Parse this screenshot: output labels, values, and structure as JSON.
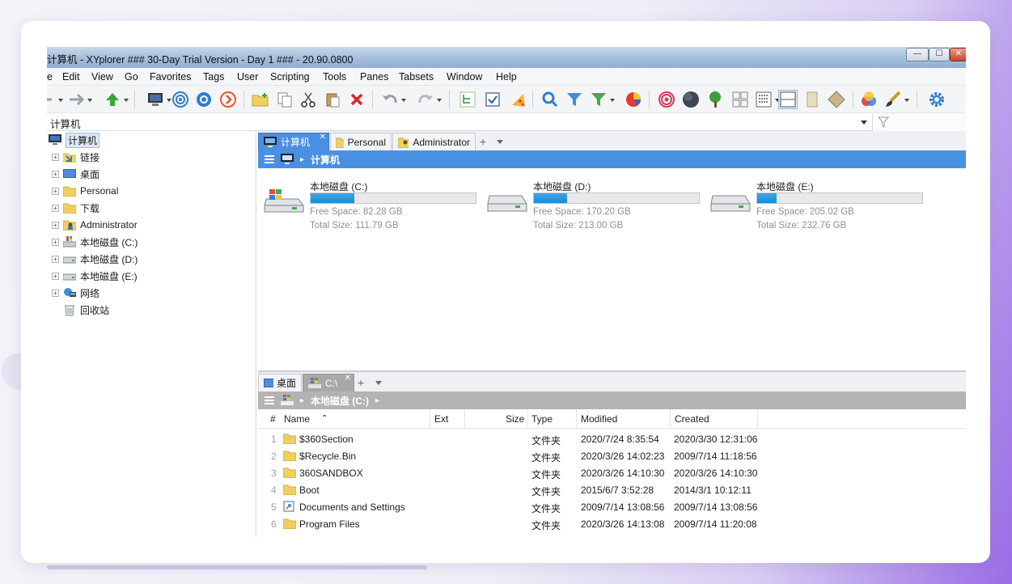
{
  "window": {
    "title": "计算机 - XYplorer ### 30-Day Trial Version - Day 1 ### - 20.90.0800",
    "min_glyph": "—",
    "max_glyph": "☐",
    "close_glyph": "✕"
  },
  "menu": [
    "e",
    "Edit",
    "View",
    "Go",
    "Favorites",
    "Tags",
    "User",
    "Scripting",
    "Tools",
    "Panes",
    "Tabsets",
    "Window",
    "Help"
  ],
  "toolbar": {
    "icons": [
      "back-arrow-icon",
      "forward-arrow-icon",
      "up-arrow-icon",
      "computer-icon",
      "target-icon",
      "find-files-icon",
      "next-icon",
      "new-folder-icon",
      "copy-icon",
      "cut-icon",
      "paste-icon",
      "delete-icon",
      "undo-icon",
      "redo-icon",
      "tree-icon",
      "checkbox-icon",
      "pizza-icon",
      "search-icon",
      "filter-icon",
      "visual-filter-icon",
      "pie-chart-icon",
      "spiral-icon",
      "moon-icon",
      "tree-plant-icon",
      "grid-view-icon",
      "details-view-icon",
      "dual-pane-icon",
      "panel-icon",
      "diamond-icon",
      "color-circles-icon",
      "brush-icon",
      "settings-icon"
    ]
  },
  "address": {
    "value": "计算机",
    "filter_icon": "funnel-icon"
  },
  "tree": [
    {
      "label": "计算机",
      "icon": "computer-icon",
      "level": 0,
      "selected": true
    },
    {
      "label": "链接",
      "icon": "folder-link-icon",
      "level": 1
    },
    {
      "label": "桌面",
      "icon": "desktop-icon",
      "level": 1
    },
    {
      "label": "Personal",
      "icon": "folder-icon",
      "level": 1
    },
    {
      "label": "下载",
      "icon": "folder-icon",
      "level": 1
    },
    {
      "label": "Administrator",
      "icon": "user-folder-icon",
      "level": 1
    },
    {
      "label": "本地磁盘 (C:)",
      "icon": "system-drive-icon",
      "level": 1
    },
    {
      "label": "本地磁盘 (D:)",
      "icon": "drive-icon",
      "level": 1
    },
    {
      "label": "本地磁盘 (E:)",
      "icon": "drive-icon",
      "level": 1
    },
    {
      "label": "网络",
      "icon": "network-icon",
      "level": 1
    },
    {
      "label": "回收站",
      "icon": "recycle-bin-icon",
      "level": 1
    }
  ],
  "top_pane": {
    "tabs": [
      "计算机",
      "Personal",
      "Administrator"
    ],
    "crumb": "计算机",
    "drives": [
      {
        "name": "本地磁盘 (C:)",
        "free": "Free Space: 82.28 GB",
        "total": "Total Size: 111.79 GB",
        "used_fraction": 0.264
      },
      {
        "name": "本地磁盘 (D:)",
        "free": "Free Space: 170.20 GB",
        "total": "Total Size: 213.00 GB",
        "used_fraction": 0.201
      },
      {
        "name": "本地磁盘 (E:)",
        "free": "Free Space: 205.02 GB",
        "total": "Total Size: 232.76 GB",
        "used_fraction": 0.119
      }
    ]
  },
  "bottom_pane": {
    "tabs": [
      "桌面",
      "C:\\"
    ],
    "crumb": "本地磁盘 (C:)",
    "columns": {
      "num": "#",
      "name": "Name",
      "ext": "Ext",
      "size": "Size",
      "type": "Type",
      "modified": "Modified",
      "created": "Created"
    },
    "rows": [
      {
        "num": "1",
        "name": "$360Section",
        "type": "文件夹",
        "modified": "2020/7/24 8:35:54",
        "created": "2020/3/30 12:31:06",
        "icon": "folder-icon"
      },
      {
        "num": "2",
        "name": "$Recycle.Bin",
        "type": "文件夹",
        "modified": "2020/3/26 14:02:23",
        "created": "2009/7/14 11:18:56",
        "icon": "folder-icon"
      },
      {
        "num": "3",
        "name": "360SANDBOX",
        "type": "文件夹",
        "modified": "2020/3/26 14:10:30",
        "created": "2020/3/26 14:10:30",
        "icon": "folder-icon"
      },
      {
        "num": "4",
        "name": "Boot",
        "type": "文件夹",
        "modified": "2015/6/7 3:52:28",
        "created": "2014/3/1 10:12:11",
        "icon": "folder-icon"
      },
      {
        "num": "5",
        "name": "Documents and Settings",
        "type": "文件夹",
        "modified": "2009/7/14 13:08:56",
        "created": "2009/7/14 13:08:56",
        "icon": "shortcut-icon"
      },
      {
        "num": "6",
        "name": "Program Files",
        "type": "文件夹",
        "modified": "2020/3/26 14:13:08",
        "created": "2009/7/14 11:20:08",
        "icon": "folder-icon"
      }
    ]
  },
  "colors": {
    "accent": "#4a90e2",
    "drive_fill": "#1d8ad6",
    "folder": "#e8c04a"
  }
}
